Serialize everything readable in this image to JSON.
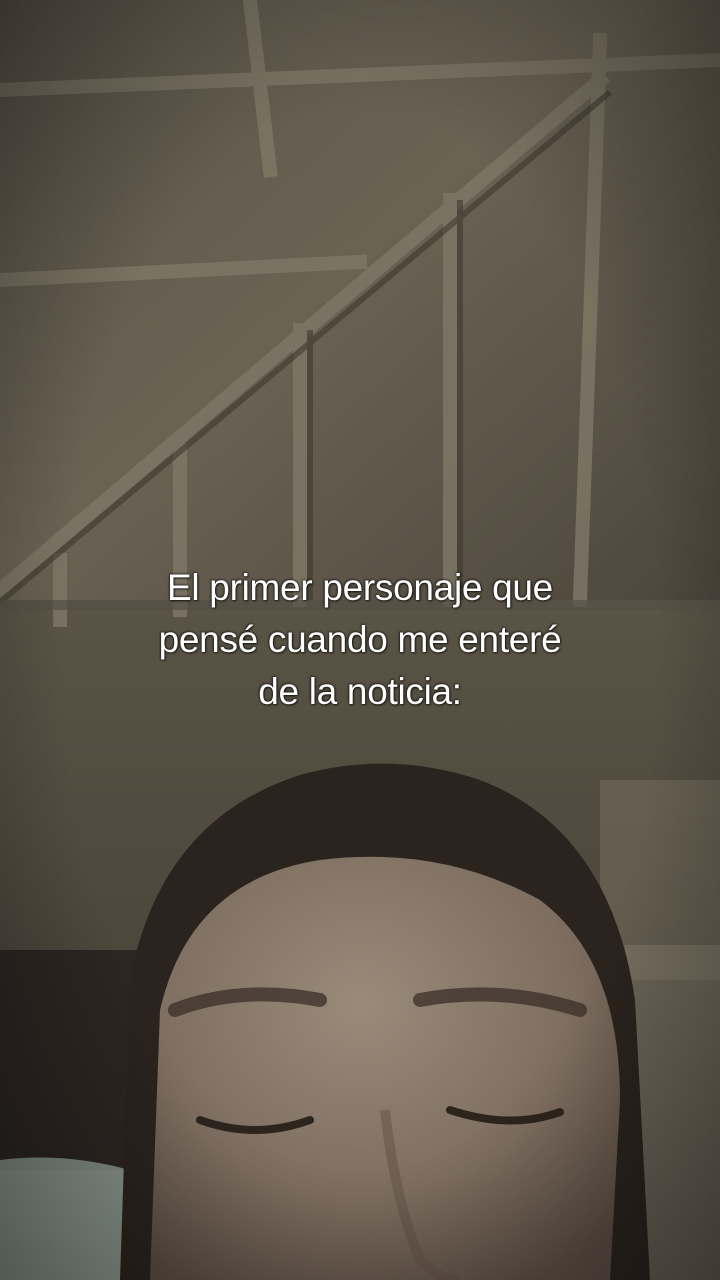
{
  "video": {
    "caption_lines": [
      "El primer personaje que",
      "pensé cuando me enteré",
      "de la noticia:"
    ]
  },
  "colors": {
    "ceiling_light": "#6e6658",
    "ceiling_dark": "#3a352d",
    "beam": "#8a8270",
    "skin": "#8a7a6c",
    "hair": "#2a221c",
    "caption_text": "#ffffff"
  }
}
